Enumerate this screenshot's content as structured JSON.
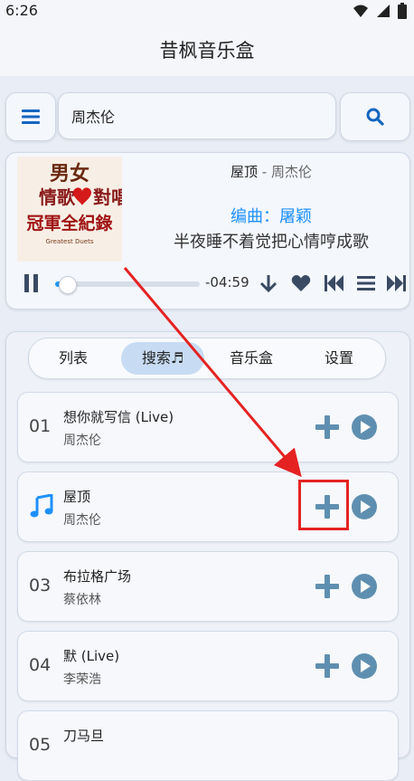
{
  "status": {
    "time": "6:26"
  },
  "app": {
    "title": "昔枫音乐盒"
  },
  "search": {
    "value": "周杰伦"
  },
  "player": {
    "song_title": "屋顶",
    "separator": " - ",
    "artist": "周杰伦",
    "lyric_line1": "编曲：屠颖",
    "lyric_line2": "半夜睡不着觉把心情哼成歌",
    "time_remaining": "-04:59",
    "progress_fraction": 0.08,
    "album_art_text": {
      "line1": "男女",
      "line2": "情歌",
      "line3": "對唱",
      "line4": "冠軍全紀錄",
      "line5": "Greatest Duets"
    }
  },
  "tabs": [
    {
      "label": "列表"
    },
    {
      "label": "搜索♬"
    },
    {
      "label": "音乐盒"
    },
    {
      "label": "设置"
    }
  ],
  "songs": [
    {
      "num": "01",
      "title": "想你就写信 (Live)",
      "artist": "周杰伦"
    },
    {
      "num": "",
      "title": "屋顶",
      "artist": "周杰伦",
      "playing": true
    },
    {
      "num": "03",
      "title": "布拉格广场",
      "artist": "蔡依林"
    },
    {
      "num": "04",
      "title": "默 (Live)",
      "artist": "李荣浩"
    },
    {
      "num": "05",
      "title": "刀马旦",
      "artist": ""
    }
  ],
  "colors": {
    "accent": "#1e90ff",
    "icon": "#3a5f8f",
    "play_circle": "#5f8fb0",
    "annotation": "#e52222"
  }
}
